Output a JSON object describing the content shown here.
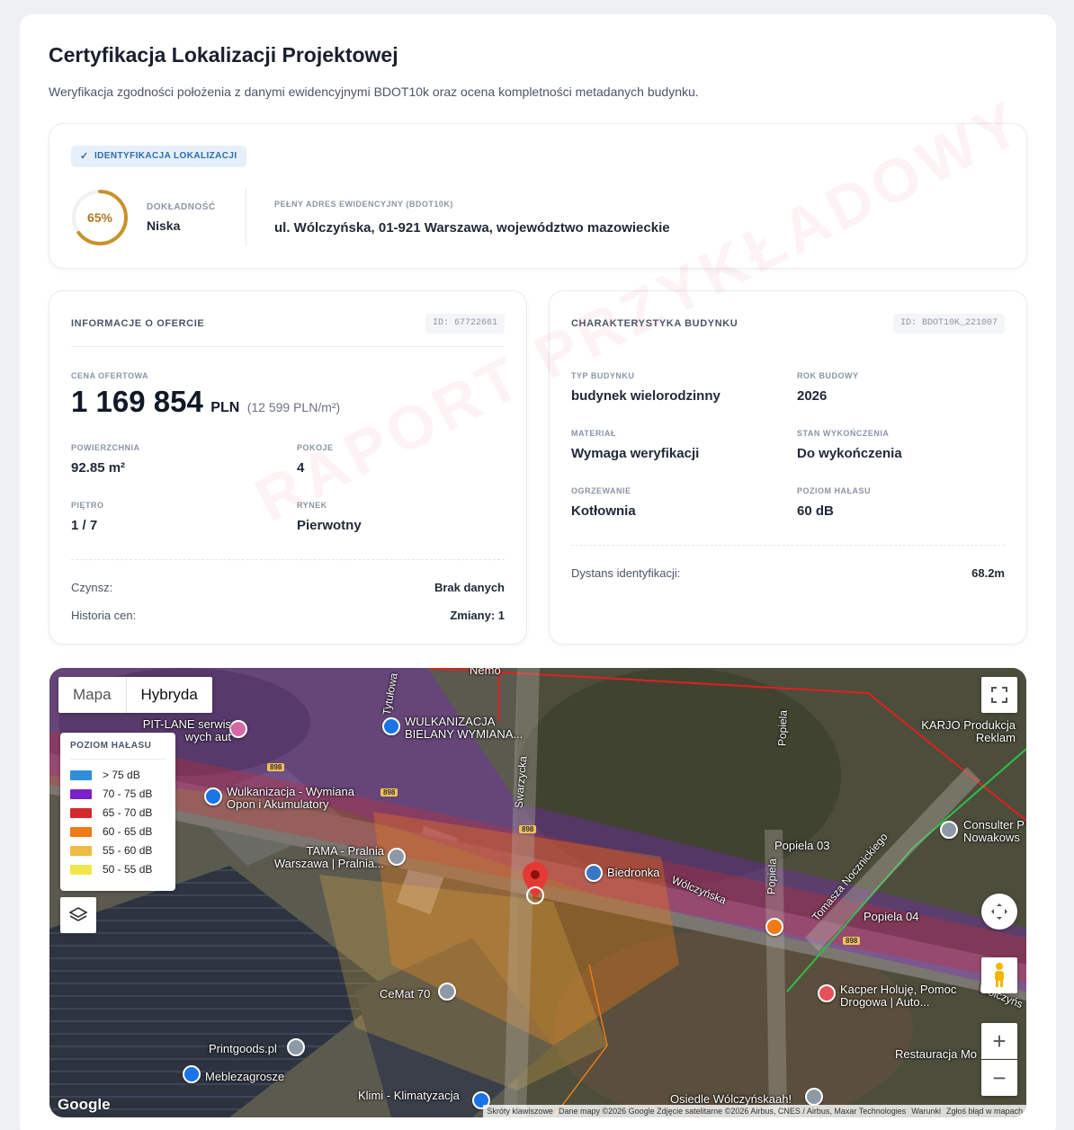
{
  "header": {
    "title": "Certyfikacja Lokalizacji Projektowej",
    "subtitle": "Weryfikacja zgodności położenia z danymi ewidencyjnymi BDOT10k oraz ocena kompletności metadanych budynku."
  },
  "location": {
    "badge": "IDENTYFIKACJA LOKALIZACJI",
    "accuracy_value": 0.65,
    "accuracy_text": "65%",
    "accuracy_label": "DOKŁADNOŚĆ",
    "accuracy_level": "Niska",
    "address_label": "PEŁNY ADRES EWIDENCYJNY (BDOT10K)",
    "address": "ul. Wólczyńska, 01-921 Warszawa, województwo mazowieckie",
    "ring_color": "#c8922a"
  },
  "offer": {
    "title": "INFORMACJE O OFERCIE",
    "id": "ID: 67722661",
    "price_label": "CENA OFERTOWA",
    "price": "1 169 854",
    "currency": "PLN",
    "price_per_m2": "(12 599 PLN/m²)",
    "area_label": "POWIERZCHNIA",
    "area": "92.85 m²",
    "rooms_label": "POKOJE",
    "rooms": "4",
    "floor_label": "PIĘTRO",
    "floor": "1 / 7",
    "market_label": "RYNEK",
    "market": "Pierwotny",
    "rent_label": "Czynsz:",
    "rent": "Brak danych",
    "history_label": "Historia cen:",
    "history": "Zmiany: 1"
  },
  "building": {
    "title": "CHARAKTERYSTYKA BUDYNKU",
    "id": "ID: BDOT10K_221007",
    "type_label": "TYP BUDYNKU",
    "type": "budynek wielorodzinny",
    "year_label": "ROK BUDOWY",
    "year": "2026",
    "material_label": "MATERIAŁ",
    "material": "Wymaga weryfikacji",
    "finish_label": "STAN WYKOŃCZENIA",
    "finish": "Do wykończenia",
    "heating_label": "OGRZEWANIE",
    "heating": "Kotłownia",
    "noise_label": "POZIOM HAŁASU",
    "noise": "60 dB",
    "distance_label": "Dystans identyfikacji:",
    "distance": "68.2m"
  },
  "watermark": "RAPORT PRZYKŁADOWY",
  "map": {
    "type_map": "Mapa",
    "type_hybrid": "Hybryda",
    "legend_title": "POZIOM HAŁASU",
    "legend": [
      {
        "label": "> 75 dB",
        "color": "#2f8fdc"
      },
      {
        "label": "70 - 75 dB",
        "color": "#7a22c9"
      },
      {
        "label": "65 - 70 dB",
        "color": "#d42a2a"
      },
      {
        "label": "60 - 65 dB",
        "color": "#f07a14"
      },
      {
        "label": "55 - 60 dB",
        "color": "#f0bb45"
      },
      {
        "label": "50 - 55 dB",
        "color": "#f2e64a"
      }
    ],
    "pois": {
      "pitlane": "PIT-LANE serwis wych aut",
      "wulk1": "WULKANIZACJA BIELANY WYMIANA...",
      "wulk2": "Wulkanizacja - Wymiana Opon i Akumulatory",
      "tama": "TAMA - Pralnia Warszawa | Pralnia...",
      "biedronka": "Biedronka",
      "popiela03": "Popiela 03",
      "popiela04": "Popiela 04",
      "karjo": "KARJO Produkcja Reklam",
      "consulter": "Consulter P Nowakows",
      "kacper": "Kacper Holuję, Pomoc Drogowa | Auto...",
      "cemat": "CeMat 70",
      "printgoods": "Printgoods.pl",
      "meble": "Meblezagrosze",
      "klimi": "Klimi - Klimatyzacja",
      "osiedle": "Osiedle Wólczyńskaah!",
      "restauracja": "Restauracja Mo",
      "nemo": "Nemo"
    },
    "roads": {
      "tytulowa": "Tytułowa",
      "swarzycka": "Swarzycka",
      "popiela": "Popiela",
      "popiela2": "Popiela",
      "tomasza": "Tomasza Nocznickiego",
      "wolczynska": "Wólczyńska",
      "wolczynska2": "Wólczyńs",
      "num": "898"
    },
    "attribution": {
      "shortcuts": "Skróty klawiszowe",
      "data": "Dane mapy ©2026 Google Zdjęcie satelitarne ©2026 Airbus, CNES / Airbus, Maxar Technologies",
      "terms": "Warunki",
      "report": "Zgłoś błąd w mapach",
      "logo": "Google"
    }
  }
}
